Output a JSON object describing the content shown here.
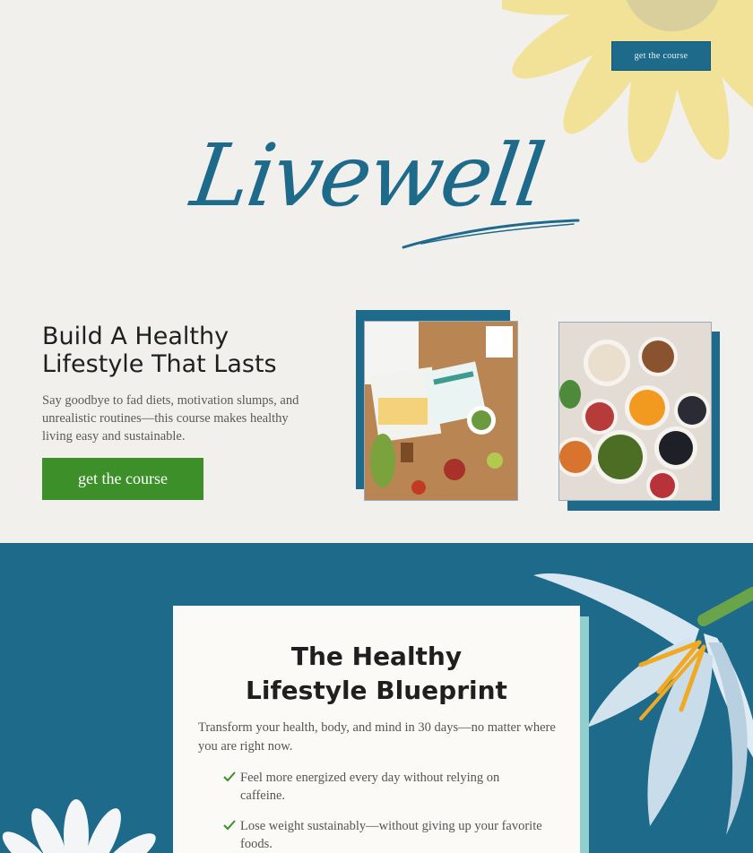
{
  "header": {
    "top_cta_label": "get the course",
    "logo_text": "Livewell"
  },
  "hero": {
    "headline": "Build A Healthy Lifestyle That Lasts",
    "subtext": "Say goodbye to fad diets, motivation slumps, and unrealistic routines—this course makes healthy living easy and sustainable.",
    "cta_label": "get the course",
    "images": [
      {
        "alt": "meal-planning-table-photo"
      },
      {
        "alt": "healthy-ingredients-bowls-photo"
      }
    ]
  },
  "blueprint": {
    "title": "The Healthy Lifestyle Blueprint",
    "description": "Transform your health, body, and mind in 30 days—no matter where you are right now.",
    "bullets": [
      "Feel more energized every day without relying on caffeine.",
      "Lose weight sustainably—without giving up your favorite foods."
    ]
  },
  "colors": {
    "brand_blue": "#1d6a8a",
    "cta_green": "#3c8f29",
    "background": "#f1f0ed",
    "card_accent": "#8fcfcc"
  }
}
